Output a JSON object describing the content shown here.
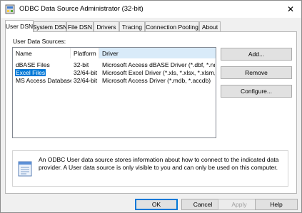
{
  "window": {
    "title": "ODBC Data Source Administrator (32-bit)",
    "icon": "odbc-app-icon",
    "close": "✕"
  },
  "tabs": [
    {
      "label": "User DSN",
      "active": true
    },
    {
      "label": "System DSN"
    },
    {
      "label": "File DSN"
    },
    {
      "label": "Drivers"
    },
    {
      "label": "Tracing"
    },
    {
      "label": "Connection Pooling"
    },
    {
      "label": "About"
    }
  ],
  "panel": {
    "list_label": "User Data Sources:",
    "columns": [
      "Name",
      "Platform",
      "Driver"
    ],
    "rows": [
      {
        "name": "dBASE Files",
        "platform": "32-bit",
        "driver": "Microsoft Access dBASE Driver (*.dbf, *.ndx, *.mdx)",
        "selected": false
      },
      {
        "name": "Excel Files",
        "platform": "32/64-bit",
        "driver": "Microsoft Excel Driver (*.xls, *.xlsx, *.xlsm, *.xlsb)",
        "selected": true
      },
      {
        "name": "MS Access Database",
        "platform": "32/64-bit",
        "driver": "Microsoft Access Driver (*.mdb, *.accdb)",
        "selected": false
      }
    ],
    "buttons": {
      "add": "Add...",
      "remove": "Remove",
      "configure": "Configure..."
    },
    "info": "An ODBC User data source stores information about how to connect to the indicated data provider.   A User data source is only visible to you and can only be used on this computer."
  },
  "footer": {
    "ok": "OK",
    "cancel": "Cancel",
    "apply": "Apply",
    "help": "Help"
  },
  "colors": {
    "selection": "#0078d7",
    "sorted_column": "#d9ebf9",
    "default_button_border": "#0078d7"
  }
}
